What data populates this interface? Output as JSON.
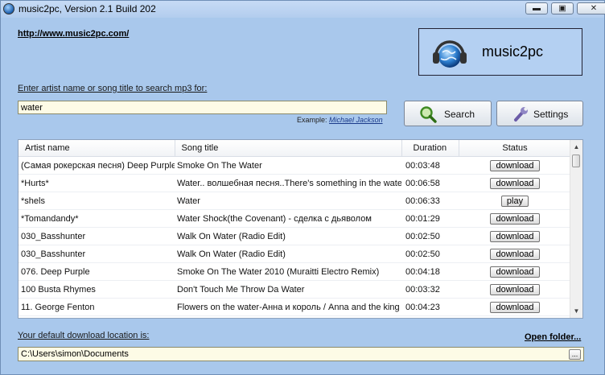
{
  "window": {
    "title": "music2pc, Version 2.1 Build 202",
    "minimize_label": "▬",
    "maximize_label": "▣",
    "close_label": "✕"
  },
  "header": {
    "site_link": "http://www.music2pc.com/",
    "logo_text": "music2pc",
    "logo_icon": "globe-headphones-icon"
  },
  "search": {
    "label": "Enter artist name or song title to search mp3 for:",
    "value": "water",
    "example_prefix": "Example:",
    "example_link": "Michael Jackson",
    "search_button": "Search",
    "search_icon": "magnifier-icon",
    "settings_button": "Settings",
    "settings_icon": "wrench-icon"
  },
  "results": {
    "columns": [
      "Artist name",
      "Song title",
      "Duration",
      "Status"
    ],
    "rows": [
      {
        "artist": "(Самая рокерская песня) Deep Purple",
        "song": "Smoke On The Water",
        "duration": "00:03:48",
        "status": "download"
      },
      {
        "artist": "*Hurts*",
        "song": "Water.. волшебная песня..There's something in the water",
        "duration": "00:06:58",
        "status": "download"
      },
      {
        "artist": "*shels",
        "song": "Water",
        "duration": "00:06:33",
        "status": "play"
      },
      {
        "artist": "*Tomandandy*",
        "song": "Water Shock(the Covenant) - сделка с дьяволом",
        "duration": "00:01:29",
        "status": "download"
      },
      {
        "artist": "030_Basshunter",
        "song": "Walk On Water (Radio Edit)",
        "duration": "00:02:50",
        "status": "download"
      },
      {
        "artist": "030_Basshunter",
        "song": "Walk On Water (Radio Edit)",
        "duration": "00:02:50",
        "status": "download"
      },
      {
        "artist": "076. Deep Purple",
        "song": "Smoke On The Water 2010 (Muraitti Electro Remix)",
        "duration": "00:04:18",
        "status": "download"
      },
      {
        "artist": "100 Busta Rhymes",
        "song": "Don't Touch Me Throw Da Water",
        "duration": "00:03:32",
        "status": "download"
      },
      {
        "artist": "11. George Fenton",
        "song": "Flowers on the water-Анна и король / Anna and the king",
        "duration": "00:04:23",
        "status": "download"
      }
    ]
  },
  "footer": {
    "download_label": "Your default download location is:",
    "open_folder": "Open folder...",
    "path": "C:\\Users\\simon\\Documents",
    "browse_label": "..."
  }
}
